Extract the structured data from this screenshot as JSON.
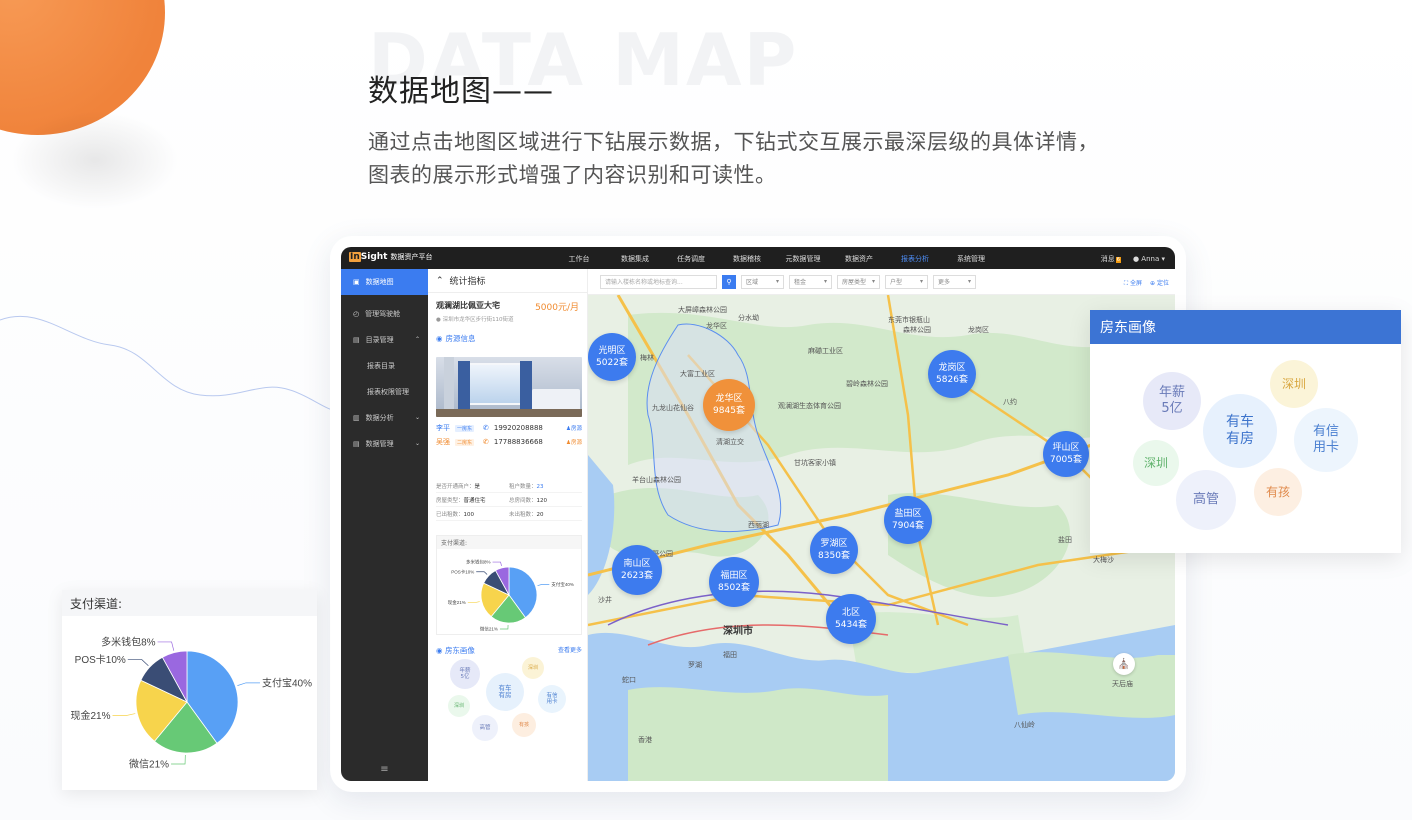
{
  "hero": {
    "bg_text": "DATA MAP",
    "title": "数据地图——",
    "desc_line1": "通过点击地图区域进行下钻展示数据，下钻式交互展示最深层级的具体详情，",
    "desc_line2": "图表的展示形式增强了内容识别和可读性。"
  },
  "app": {
    "logo_mark": "In",
    "logo_rest": "Sight",
    "logo_sub": "数据资产平台",
    "nav": [
      "工作台",
      "数据集成",
      "任务调度",
      "数据稽核",
      "元数据管理",
      "数据资产",
      "报表分析",
      "系统管理"
    ],
    "nav_active_index": 6,
    "messages_label": "消息",
    "messages_badge": "6",
    "user": "Anna"
  },
  "sidebar": {
    "items": [
      {
        "label": "数据地图",
        "icon": "map-icon",
        "active": true
      },
      {
        "label": "管理驾驶舱",
        "icon": "dashboard-icon"
      },
      {
        "label": "目录管理",
        "icon": "catalog-icon",
        "caret": "^"
      },
      {
        "label": "报表目录",
        "sub": true
      },
      {
        "label": "报表权限管理",
        "sub": true
      },
      {
        "label": "数据分析",
        "icon": "chart-icon",
        "caret": "v"
      },
      {
        "label": "数据管理",
        "icon": "data-icon",
        "caret": "v"
      }
    ],
    "bottom_icon": "≡"
  },
  "panel": {
    "header": "统计指标",
    "property_title": "观澜湖比佩亚大宅",
    "price": "5000元/月",
    "address": "深圳市龙华区步行街110街道",
    "house_info": "房源信息",
    "contacts": [
      {
        "name": "李平",
        "tag": "一房东",
        "phone": "19920208888",
        "role": "房源"
      },
      {
        "name": "吴强",
        "tag": "二房东",
        "phone": "17788836668",
        "role": "房源"
      }
    ],
    "stats": [
      [
        "是否开通商户：",
        "是",
        "租户数量：",
        "23"
      ],
      [
        "房屋类型：",
        "普通住宅",
        "总房间数：",
        "120"
      ],
      [
        "已出租数：",
        "100",
        "未出租数：",
        "20"
      ]
    ],
    "pay_title": "支付渠道:",
    "portrait_title": "房东画像",
    "portrait_more": "查看更多"
  },
  "toolbar": {
    "search_placeholder": "请输入楼栋名称或地标查询...",
    "filters": [
      "区域",
      "租金",
      "房屋类型",
      "户型",
      "更多"
    ],
    "fullscreen": "全屏",
    "locate": "定位"
  },
  "map": {
    "districts": [
      {
        "name": "光明区",
        "count": "5022套",
        "color": "blue"
      },
      {
        "name": "龙华区",
        "count": "9845套",
        "color": "orange"
      },
      {
        "name": "龙岗区",
        "count": "5826套",
        "color": "blue"
      },
      {
        "name": "坪山区",
        "count": "7005套",
        "color": "blue"
      },
      {
        "name": "盐田区",
        "count": "7904套",
        "color": "blue"
      },
      {
        "name": "罗湖区",
        "count": "8350套",
        "color": "blue"
      },
      {
        "name": "南山区",
        "count": "2623套",
        "color": "blue"
      },
      {
        "name": "福田区",
        "count": "8502套",
        "color": "blue"
      },
      {
        "name": "北区",
        "count": "5434套",
        "color": "blue"
      }
    ],
    "labels": [
      "大屏嶂森林公园",
      "东莞市银瓶山",
      "森林公园",
      "分水坳",
      "龙华区",
      "梅林",
      "大富工业区",
      "九龙山花仙谷",
      "观澜湖生态体育公园",
      "麻磡工业区",
      "碧岭森林公园",
      "龙岗区",
      "八约",
      "清湖立交",
      "羊台山森林公园",
      "塘朗山郊野公园",
      "甘坑客家小镇",
      "深圳市",
      "罗湖",
      "福田",
      "西丽湖",
      "蛇口",
      "沙井",
      "香港",
      "天后庙",
      "大梅沙",
      "盐田",
      "八仙岭"
    ],
    "landmark": "天后庙"
  },
  "portrait_card": {
    "title": "房东画像",
    "tags": [
      "年薪\n5亿",
      "深圳",
      "有车\n有房",
      "有信\n用卡",
      "深圳",
      "高管",
      "有孩"
    ]
  },
  "pay_card": {
    "title": "支付渠道:"
  },
  "chart_data": {
    "type": "pie",
    "title": "支付渠道:",
    "slices": [
      {
        "label": "支付宝40%",
        "value": 40,
        "color": "#58a0f5"
      },
      {
        "label": "微信21%",
        "value": 21,
        "color": "#67c976"
      },
      {
        "label": "现金21%",
        "value": 21,
        "color": "#f7d44c"
      },
      {
        "label": "POS卡10%",
        "value": 10,
        "color": "#3a4d75"
      },
      {
        "label": "多米钱包8%",
        "value": 8,
        "color": "#9a68e0"
      }
    ]
  }
}
